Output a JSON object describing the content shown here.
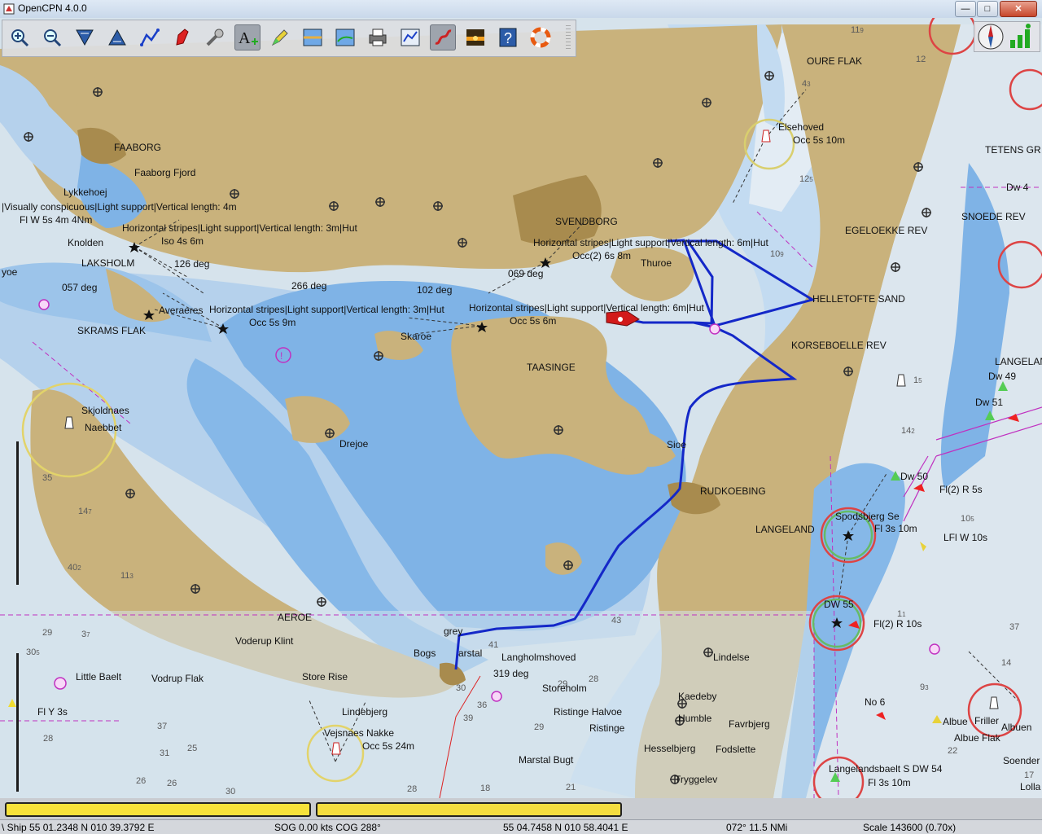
{
  "window": {
    "title": "OpenCPN 4.0.0"
  },
  "toolbar": {
    "buttons": [
      {
        "name": "zoom-in-button",
        "icon": "zoom-in-icon"
      },
      {
        "name": "zoom-out-button",
        "icon": "zoom-out-icon"
      },
      {
        "name": "scale-in-button",
        "icon": "scale-in-icon"
      },
      {
        "name": "scale-out-button",
        "icon": "scale-out-icon"
      },
      {
        "name": "route-button",
        "icon": "route-icon"
      },
      {
        "name": "auto-follow-button",
        "icon": "ship-icon"
      },
      {
        "name": "settings-button",
        "icon": "wrench-icon"
      },
      {
        "name": "text-button",
        "icon": "text-icon",
        "active": true
      },
      {
        "name": "current-tide-button",
        "icon": "pencil-icon"
      },
      {
        "name": "tide-button",
        "icon": "tide-icon"
      },
      {
        "name": "current-button",
        "icon": "current-icon"
      },
      {
        "name": "print-button",
        "icon": "print-icon"
      },
      {
        "name": "route-manager-button",
        "icon": "route-manager-icon"
      },
      {
        "name": "track-button",
        "icon": "track-icon",
        "active": true
      },
      {
        "name": "color-scheme-button",
        "icon": "sunset-icon"
      },
      {
        "name": "help-button",
        "icon": "help-icon"
      },
      {
        "name": "mob-button",
        "icon": "lifebuoy-icon"
      }
    ]
  },
  "chart": {
    "labels": [
      {
        "text": "FAABORG"
      },
      {
        "text": "Faaborg Fjord"
      },
      {
        "text": "Lykkehoej"
      },
      {
        "text": "|Visually conspicuous|Light support|Vertical length: 4m"
      },
      {
        "text": "Fl W 5s 4m 4Nm"
      },
      {
        "text": "Horizontal stripes|Light support|Vertical length: 3m|Hut"
      },
      {
        "text": "Iso 4s 6m"
      },
      {
        "text": "Knolden"
      },
      {
        "text": "LAKSHOLM"
      },
      {
        "text": "126 deg"
      },
      {
        "text": "057 deg"
      },
      {
        "text": "266 deg"
      },
      {
        "text": "102 deg"
      },
      {
        "text": "069 deg"
      },
      {
        "text": "yoe"
      },
      {
        "text": "Horizontal stripes|Light support|Vertical length: 3m|Hut"
      },
      {
        "text": "Occ 5s 9m"
      },
      {
        "text": "SKRAMS FLAK"
      },
      {
        "text": "Averaeres"
      },
      {
        "text": "SVENDBORG"
      },
      {
        "text": "Horizontal stripes|Light support|Vertical length: 6m|Hut"
      },
      {
        "text": "Occ(2) 6s 8m"
      },
      {
        "text": "Thuroe"
      },
      {
        "text": "Horizontal stripes|Light support|Vertical length: 6m|Hut"
      },
      {
        "text": "Occ 5s 6m"
      },
      {
        "text": "Skaroe"
      },
      {
        "text": "TAASINGE"
      },
      {
        "text": "Skjoldnaes"
      },
      {
        "text": "Naebbet"
      },
      {
        "text": "Drejoe"
      },
      {
        "text": "Sioe"
      },
      {
        "text": "RUDKOEBING"
      },
      {
        "text": "LANGELAND"
      },
      {
        "text": "OURE FLAK"
      },
      {
        "text": "Elsehoved"
      },
      {
        "text": "Occ 5s 10m"
      },
      {
        "text": "EGELOEKKE REV"
      },
      {
        "text": "HELLETOFTE SAND"
      },
      {
        "text": "KORSEBOELLE REV"
      },
      {
        "text": "TETENS GR"
      },
      {
        "text": "SNOEDE REV"
      },
      {
        "text": "LANGELAN"
      },
      {
        "text": "Dw 49"
      },
      {
        "text": "Dw 51"
      },
      {
        "text": "Dw 50"
      },
      {
        "text": "Fl(2) R 5s"
      },
      {
        "text": "Spodsbjerg Se"
      },
      {
        "text": "Fl 3s 10m"
      },
      {
        "text": "LFl W 10s"
      },
      {
        "text": "DW 55"
      },
      {
        "text": "Fl(2) R 10s"
      },
      {
        "text": "Lindelse"
      },
      {
        "text": "Kaedeby"
      },
      {
        "text": "Humble"
      },
      {
        "text": "Favrbjerg"
      },
      {
        "text": "Hesselbjerg"
      },
      {
        "text": "Fodslette"
      },
      {
        "text": "Tryggelev"
      },
      {
        "text": "Langholmshoved"
      },
      {
        "text": "319 deg"
      },
      {
        "text": "Storeholm"
      },
      {
        "text": "Ristinge Halvoe"
      },
      {
        "text": "Ristinge"
      },
      {
        "text": "Marstal Bugt"
      },
      {
        "text": "grey"
      },
      {
        "text": "arstal"
      },
      {
        "text": "Voderup Klint"
      },
      {
        "text": "Store Rise"
      },
      {
        "text": "Little Baelt"
      },
      {
        "text": "Vodrup Flak"
      },
      {
        "text": "Fl Y 3s"
      },
      {
        "text": "Lindebjerg"
      },
      {
        "text": "Vejsnaes Nakke"
      },
      {
        "text": "Occ 5s 24m"
      },
      {
        "text": "No 6"
      },
      {
        "text": "Albue"
      },
      {
        "text": "Albue Flak"
      },
      {
        "text": "Friller"
      },
      {
        "text": "Albuen"
      },
      {
        "text": "Langelandsbaelt S DW 54"
      },
      {
        "text": "Fl 3s 10m"
      },
      {
        "text": "Soender"
      },
      {
        "text": "Lolla"
      },
      {
        "text": "AEROE"
      },
      {
        "text": "Bogs"
      },
      {
        "text": "Dw 4"
      }
    ]
  },
  "status": {
    "ship": "\\ Ship 55 01.2348 N   010 39.3792 E",
    "sog": "SOG 0.00 kts  COG 288°",
    "cursor": "55 04.7458 N   010 58.4041 E",
    "bearing": "072°  11.5 NMi",
    "scale": "Scale 143600 (0.70x)"
  },
  "colors": {
    "land": "#c9b27c",
    "shallow": "#7fb3e6",
    "mid": "#b7d3ef",
    "deep": "#dce6ee",
    "route": "#1428c8",
    "magenta": "#c030c0",
    "town": "#a88b4e"
  }
}
